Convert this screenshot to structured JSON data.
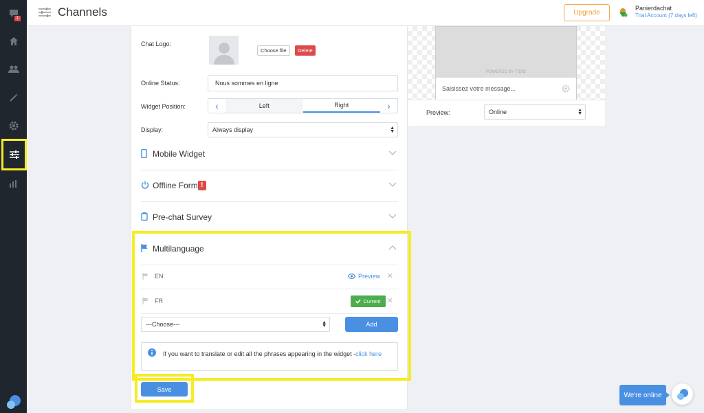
{
  "header": {
    "title": "Channels",
    "upgrade_label": "Upgrade",
    "account_name": "Panierdachat",
    "account_status": "Trial Account (7 days left)"
  },
  "sidebar": {
    "badge_count": "1",
    "items": [
      {
        "icon": "chat-icon"
      },
      {
        "icon": "home-icon"
      },
      {
        "icon": "users-icon"
      },
      {
        "icon": "magic-wand-icon"
      },
      {
        "icon": "gear-icon"
      },
      {
        "icon": "sliders-icon",
        "active": true
      },
      {
        "icon": "bar-chart-icon"
      }
    ]
  },
  "form": {
    "chat_logo_label": "Chat Logo:",
    "choose_file_label": "Choose file",
    "delete_label": "Delete",
    "online_status_label": "Online Status:",
    "online_status_value": "Nous sommes en ligne",
    "widget_position_label": "Widget Position:",
    "position_left": "Left",
    "position_right": "Right",
    "display_label": "Display:",
    "display_value": "Always display"
  },
  "sections": {
    "mobile_widget": "Mobile Widget",
    "offline_form": "Offline Form",
    "offline_form_alert": "!",
    "pre_chat_survey": "Pre-chat Survey",
    "multilanguage": "Multilanguage"
  },
  "multilanguage": {
    "languages": [
      {
        "code": "EN",
        "action": "Preview"
      },
      {
        "code": "FR",
        "action": "Current"
      }
    ],
    "choose_placeholder": "---Choose---",
    "add_label": "Add",
    "info_text": "If you want to translate or edit all the phrases appearing in the widget -",
    "info_link": "click here"
  },
  "save_label": "Save",
  "preview": {
    "powered_by": "POWERED BY TIDIO",
    "message_placeholder": "Saisissez votre message...",
    "preview_label": "Preview:",
    "preview_value": "Online"
  },
  "chat_widget": {
    "online_label": "We're online"
  },
  "colors": {
    "accent": "#4a90e2",
    "highlight": "#f5ec24",
    "sidebar": "#20262e",
    "danger": "#dc4a4a",
    "success": "#4cae4c",
    "upgrade": "#f0a030"
  }
}
